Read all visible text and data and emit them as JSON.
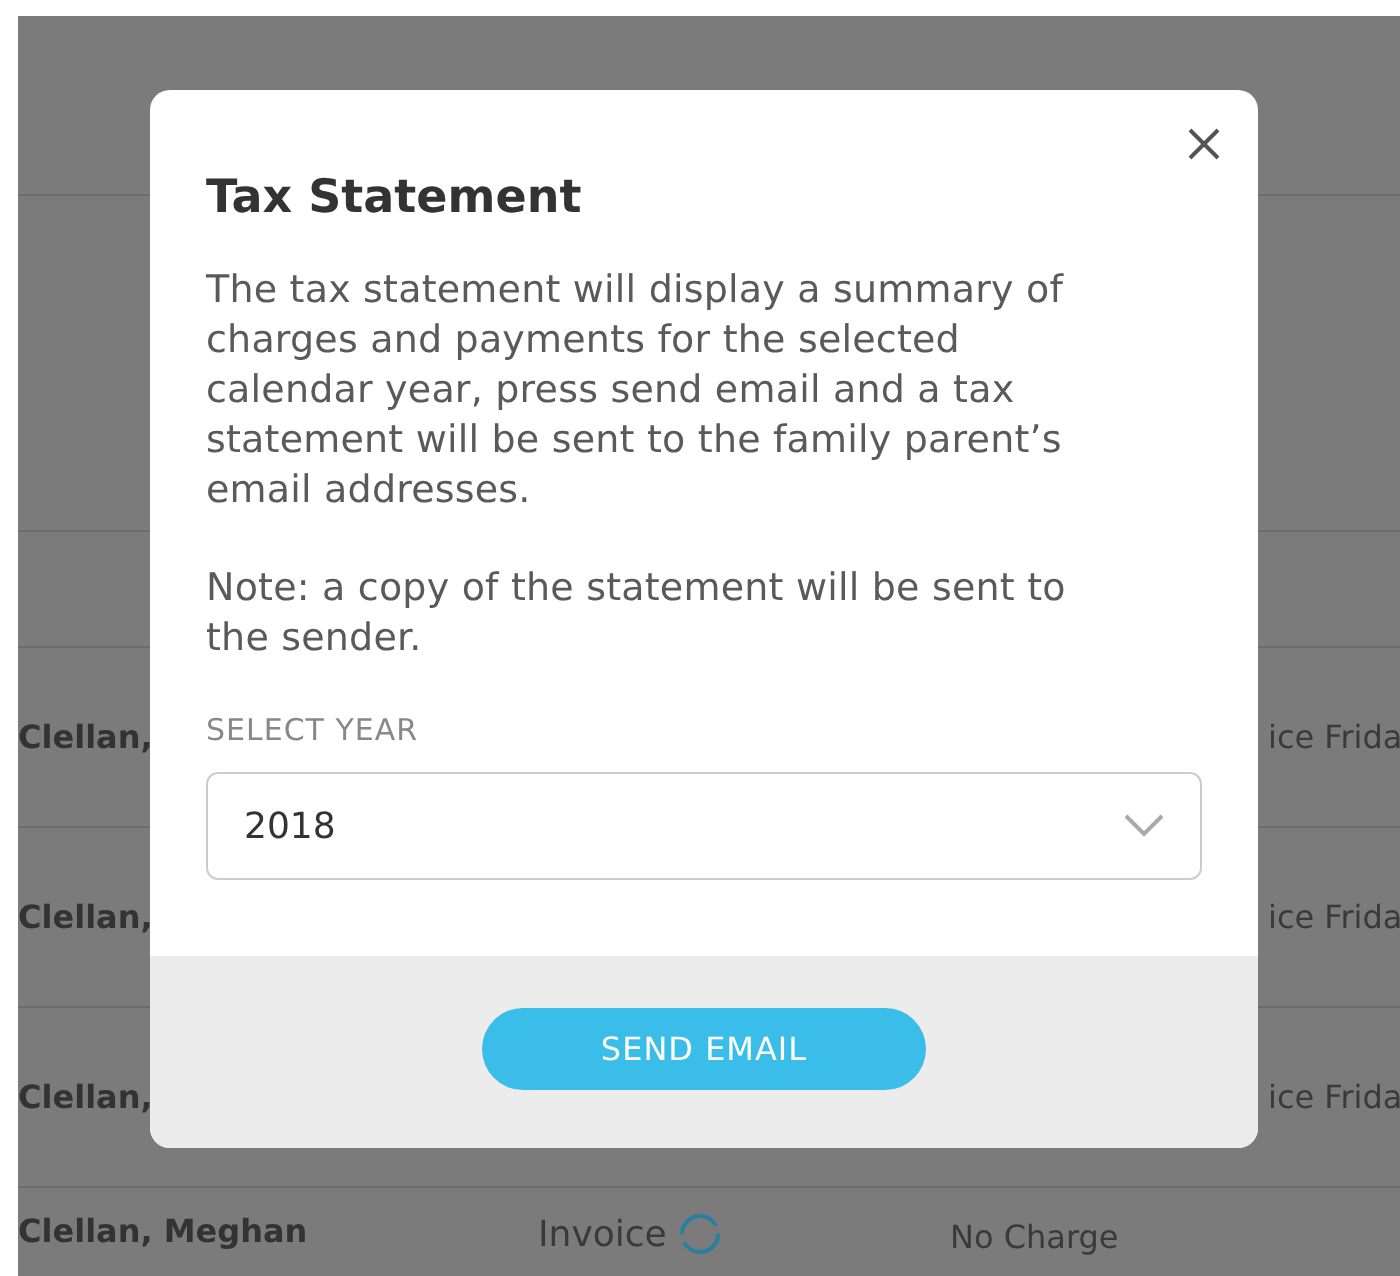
{
  "background_table": {
    "rows": [
      {
        "name": "Clellan,",
        "column_3": "ice Frida"
      },
      {
        "name": "Clellan,",
        "column_3": "ice Frida"
      },
      {
        "name": "Clellan,",
        "column_3": "ice Frida"
      },
      {
        "name": "Clellan, Meghan",
        "type": "Invoice",
        "column_3": "No Charge"
      }
    ]
  },
  "modal": {
    "title": "Tax Statement",
    "paragraphs": [
      "The tax statement will display a summary of charges and payments for the selected calendar year, press send email and a tax statement will be sent to the family parent’s email addresses.",
      "Note: a copy of the statement will be sent to the sender."
    ],
    "select": {
      "label": "SELECT YEAR",
      "value": "2018"
    },
    "button": "SEND EMAIL"
  }
}
